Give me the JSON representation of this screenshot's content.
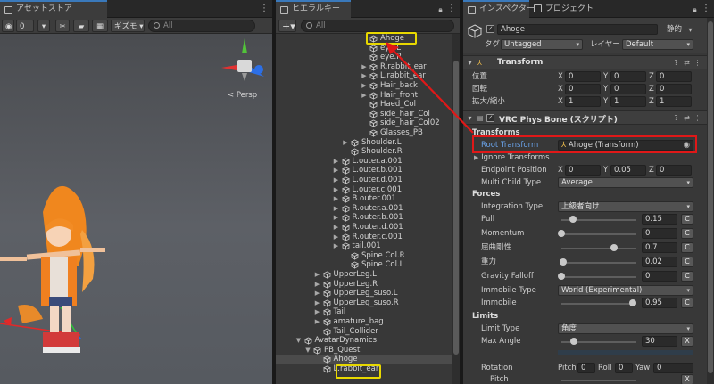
{
  "scene": {
    "tab_label": "アセットストア",
    "toolbar": {
      "layers_count": "0",
      "gizmos_label": "ギズモ",
      "search_placeholder": "All"
    },
    "persp_label": "< Persp"
  },
  "hierarchy": {
    "tab_label": "ヒエラルキー",
    "add_label": "+",
    "search_placeholder": "All",
    "rows": [
      {
        "label": "Ahoge",
        "depth": 10,
        "arrow": false
      },
      {
        "label": "eye.L",
        "depth": 10,
        "arrow": false
      },
      {
        "label": "eye.R",
        "depth": 10,
        "arrow": false
      },
      {
        "label": "R.rabbit_ear",
        "depth": 10,
        "arrow": true
      },
      {
        "label": "L.rabbit_ear",
        "depth": 10,
        "arrow": true
      },
      {
        "label": "Hair_back",
        "depth": 10,
        "arrow": true
      },
      {
        "label": "Hair_front",
        "depth": 10,
        "arrow": true
      },
      {
        "label": "Haed_Col",
        "depth": 10,
        "arrow": false
      },
      {
        "label": "side_hair_Col",
        "depth": 10,
        "arrow": false
      },
      {
        "label": "side_hair_Col02",
        "depth": 10,
        "arrow": false
      },
      {
        "label": "Glasses_PB",
        "depth": 10,
        "arrow": false
      },
      {
        "label": "Shoulder.L",
        "depth": 8,
        "arrow": true
      },
      {
        "label": "Shoulder.R",
        "depth": 8,
        "arrow": false
      },
      {
        "label": "L.outer.a.001",
        "depth": 7,
        "arrow": true
      },
      {
        "label": "L.outer.b.001",
        "depth": 7,
        "arrow": true
      },
      {
        "label": "L.outer.d.001",
        "depth": 7,
        "arrow": true
      },
      {
        "label": "L.outer.c.001",
        "depth": 7,
        "arrow": true
      },
      {
        "label": "B.outer.001",
        "depth": 7,
        "arrow": true
      },
      {
        "label": "R.outer.a.001",
        "depth": 7,
        "arrow": true
      },
      {
        "label": "R.outer.b.001",
        "depth": 7,
        "arrow": true
      },
      {
        "label": "R.outer.d.001",
        "depth": 7,
        "arrow": true
      },
      {
        "label": "R.outer.c.001",
        "depth": 7,
        "arrow": true
      },
      {
        "label": "tail.001",
        "depth": 7,
        "arrow": true
      },
      {
        "label": "Spine Col.R",
        "depth": 8,
        "arrow": false
      },
      {
        "label": "Spine Col.L",
        "depth": 8,
        "arrow": false
      },
      {
        "label": "UpperLeg.L",
        "depth": 5,
        "arrow": true
      },
      {
        "label": "UpperLeg.R",
        "depth": 5,
        "arrow": true
      },
      {
        "label": "UpperLeg_suso.L",
        "depth": 5,
        "arrow": true
      },
      {
        "label": "UpperLeg_suso.R",
        "depth": 5,
        "arrow": true
      },
      {
        "label": "Tail",
        "depth": 5,
        "arrow": true
      },
      {
        "label": "amature_bag",
        "depth": 5,
        "arrow": true
      },
      {
        "label": "Tail_Collider",
        "depth": 5,
        "arrow": false
      },
      {
        "label": "AvatarDynamics",
        "depth": 3,
        "arrow": true,
        "expanded": true
      },
      {
        "label": "PB_Quest",
        "depth": 4,
        "arrow": true,
        "expanded": true
      },
      {
        "label": "Ahoge",
        "depth": 5,
        "arrow": false,
        "selected": true
      },
      {
        "label": "L.rabbit_ear",
        "depth": 5,
        "arrow": false
      }
    ]
  },
  "inspector": {
    "tab_label": "インスペクター",
    "project_tab_label": "プロジェクト",
    "object_name": "Ahoge",
    "static_label": "静的",
    "tag_label": "タグ",
    "tag_value": "Untagged",
    "layer_label": "レイヤー",
    "layer_value": "Default",
    "transform": {
      "title": "Transform",
      "rows": [
        {
          "label": "位置",
          "x": "0",
          "y": "0",
          "z": "0"
        },
        {
          "label": "回転",
          "x": "0",
          "y": "0",
          "z": "0"
        },
        {
          "label": "拡大/縮小",
          "x": "1",
          "y": "1",
          "z": "1"
        }
      ]
    },
    "physbone": {
      "title": "VRC Phys Bone (スクリプト)",
      "transforms_header": "Transforms",
      "root_transform_label": "Root Transform",
      "root_transform_value": "Ahoge (Transform)",
      "ignore_transforms_label": "Ignore Transforms",
      "endpoint_label": "Endpoint Position",
      "endpoint": {
        "x": "0",
        "y": "0.05",
        "z": "0"
      },
      "multi_child_label": "Multi Child Type",
      "multi_child_value": "Average",
      "forces_header": "Forces",
      "integration_label": "Integration Type",
      "integration_value": "上級者向け",
      "sliders": [
        {
          "label": "Pull",
          "value": "0.15",
          "fraction": 0.15
        },
        {
          "label": "Momentum",
          "value": "0",
          "fraction": 0.0
        },
        {
          "label": "屈曲剛性",
          "value": "0.7",
          "fraction": 0.7
        },
        {
          "label": "重力",
          "value": "0.02",
          "fraction": 0.02
        },
        {
          "label": "Gravity Falloff",
          "value": "0",
          "fraction": 0.0
        }
      ],
      "immobile_type_label": "Immobile Type",
      "immobile_type_value": "World (Experimental)",
      "immobile_label": "Immobile",
      "immobile_value": "0.95",
      "immobile_fraction": 0.95,
      "limits_header": "Limits",
      "limit_type_label": "Limit Type",
      "limit_type_value": "角度",
      "max_angle_label": "Max Angle",
      "max_angle_value": "30",
      "max_angle_fraction": 0.167,
      "rotation_label": "Rotation",
      "rotation": {
        "pitch_label": "Pitch",
        "pitch": "0",
        "roll_label": "Roll",
        "roll": "0",
        "yaw_label": "Yaw",
        "yaw": "0"
      },
      "pitch_sub_label": "Pitch",
      "c_label": "C",
      "x_label": "X"
    }
  }
}
